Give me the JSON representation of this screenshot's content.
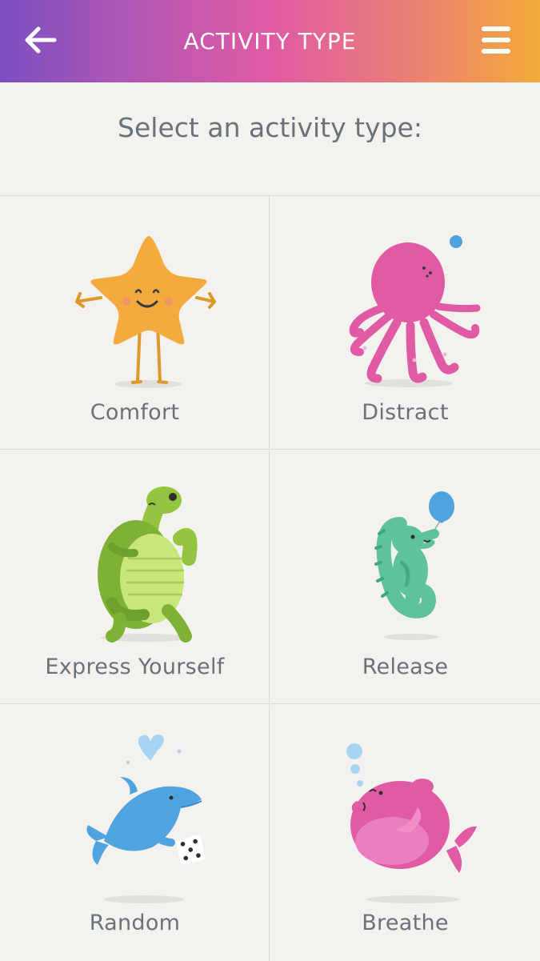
{
  "header": {
    "title": "ACTIVITY TYPE",
    "back_icon": "arrow-left-icon",
    "menu_icon": "hamburger-menu-icon"
  },
  "prompt": "Select an activity type:",
  "activities": [
    {
      "label": "Comfort",
      "icon": "starfish-icon",
      "color": "#f2ab3c"
    },
    {
      "label": "Distract",
      "icon": "octopus-icon",
      "color": "#e05aa4"
    },
    {
      "label": "Express Yourself",
      "icon": "turtle-icon",
      "color": "#93c53f"
    },
    {
      "label": "Release",
      "icon": "seahorse-icon",
      "color": "#5ec39a"
    },
    {
      "label": "Random",
      "icon": "dolphin-icon",
      "color": "#4fa4e0"
    },
    {
      "label": "Breathe",
      "icon": "whale-icon",
      "color": "#e05aa4"
    }
  ],
  "colors": {
    "background": "#f4f2ef",
    "text": "#6a7279",
    "divider": "#d8dbe0",
    "gradient_start": "#7b4fc1",
    "gradient_mid": "#e05aa4",
    "gradient_end": "#f2aa3a"
  }
}
